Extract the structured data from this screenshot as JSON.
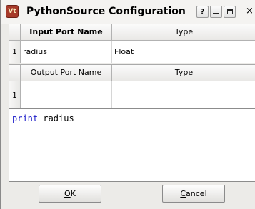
{
  "window": {
    "title": "PythonSource Configuration",
    "icon_label": "Vt",
    "help_label": "?",
    "close_label": "×"
  },
  "input_ports": {
    "header_name": "Input Port Name",
    "header_type": "Type",
    "rows": [
      {
        "index": "1",
        "name": "radius",
        "type": "Float"
      }
    ]
  },
  "output_ports": {
    "header_name": "Output Port Name",
    "header_type": "Type",
    "rows": [
      {
        "index": "1",
        "name": "",
        "type": ""
      }
    ]
  },
  "editor": {
    "keyword": "print",
    "rest": " radius",
    "keyword_color": "#1a1ac8"
  },
  "buttons": {
    "ok_mnemonic": "O",
    "ok_rest": "K",
    "cancel_mnemonic": "C",
    "cancel_rest": "ancel"
  }
}
